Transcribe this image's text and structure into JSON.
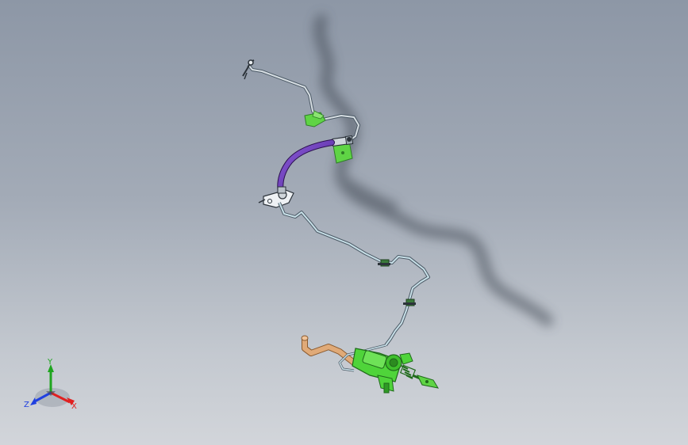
{
  "viewport": {
    "background_top": "#8d97a6",
    "background_bottom": "#d2d5da"
  },
  "model": {
    "colors": {
      "tube": "#c8d0d6",
      "tube_outline": "#4c5a66",
      "hose": "#6a35b8",
      "bracket": "#5fd445",
      "bracket_outline": "#2e7d26",
      "master_cylinder": "#4fd43a",
      "reservoir_line": "#d9a574",
      "shadow": "#3c4450"
    }
  },
  "triad": {
    "x_label": "X",
    "y_label": "Y",
    "z_label": "Z",
    "x_color": "#e02020",
    "y_color": "#1fa51f",
    "z_color": "#2040e0"
  }
}
